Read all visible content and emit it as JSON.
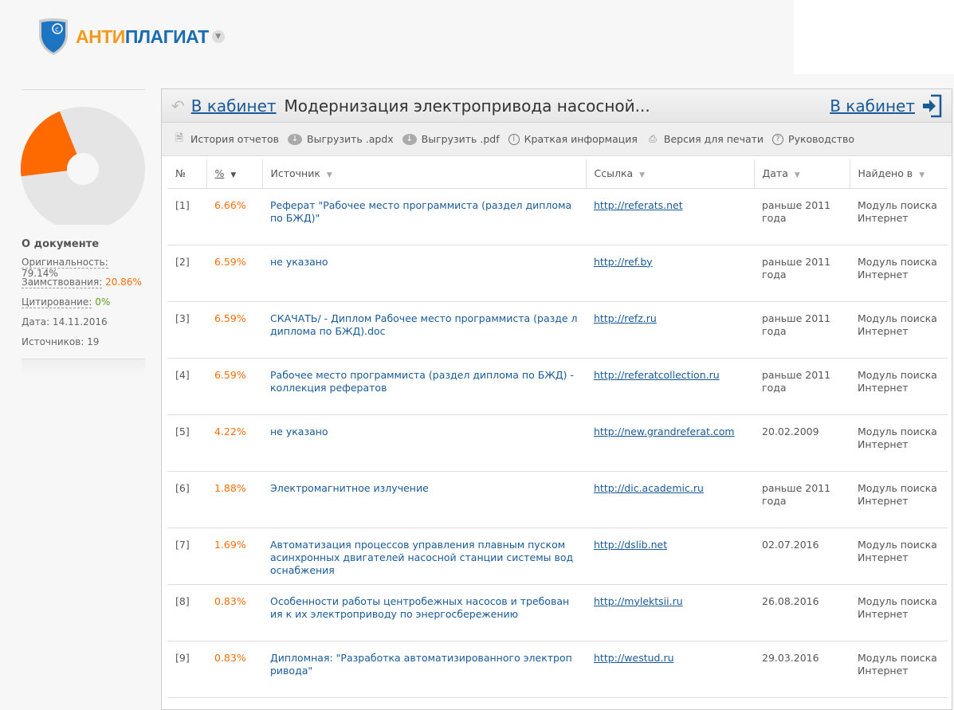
{
  "logo": {
    "part1": "АНТИ",
    "part2": "ПЛАГИАТ"
  },
  "chart_data": {
    "type": "pie",
    "values": [
      79.14,
      20.86
    ],
    "labels": [
      "Оригинальность",
      "Заимствования"
    ],
    "colors": [
      "#e5e5e5",
      "#ff6a00"
    ]
  },
  "sidebar": {
    "title": "О документе",
    "originality_label": "Оригинальность:",
    "originality": "79.14%",
    "borrowing_label": "Заимствования:",
    "borrowing": "20.86%",
    "citation_label": "Цитирование:",
    "citation": "0%",
    "date": "Дата: 14.11.2016",
    "sources": "Источников: 19"
  },
  "header": {
    "back_link": "В кабинет",
    "title": "Модернизация электропривода насосной...",
    "right_link": "В кабинет"
  },
  "toolbar": [
    "История отчетов",
    "Выгрузить .apdx",
    "Выгрузить .pdf",
    "Краткая информация",
    "Версия для печати",
    "Руководство"
  ],
  "table": {
    "columns": [
      "№",
      "%",
      "Источник",
      "Ссылка",
      "Дата",
      "Найдено в"
    ],
    "rows": [
      [
        "[1]",
        "6.66%",
        "Реферат \"Рабочее место программиста (раздел диплома по БЖД)\"",
        "http://referats.net",
        "раньше 2011 года",
        "Модуль поиска Интернет"
      ],
      [
        "[2]",
        "6.59%",
        "не указано",
        "http://ref.by",
        "раньше 2011 года",
        "Модуль поиска Интернет"
      ],
      [
        "[3]",
        "6.59%",
        "СКАЧАТЬ/ - Диплом Рабочее место программиста (разде л диплома по БЖД).doc",
        "http://refz.ru",
        "раньше 2011 года",
        "Модуль поиска Интернет"
      ],
      [
        "[4]",
        "6.59%",
        "Рабочее место программиста (раздел диплома по БЖД) - коллекция рефератов",
        "http://referatcollection.ru",
        "раньше 2011 года",
        "Модуль поиска Интернет"
      ],
      [
        "[5]",
        "4.22%",
        "не указано",
        "http://new.grandreferat.com",
        "20.02.2009",
        "Модуль поиска Интернет"
      ],
      [
        "[6]",
        "1.88%",
        "Электромагнитное излучение",
        "http://dic.academic.ru",
        "раньше 2011 года",
        "Модуль поиска Интернет"
      ],
      [
        "[7]",
        "1.69%",
        "Автоматизация процессов управления плавным пуском асинхронных двигателей насосной станции системы вод оснабжения",
        "http://dslib.net",
        "02.07.2016",
        "Модуль поиска Интернет"
      ],
      [
        "[8]",
        "0.83%",
        "Особенности работы центробежных насосов и требован ия к их электроприводу по энергосбережению",
        "http://mylektsii.ru",
        "26.08.2016",
        "Модуль поиска Интернет"
      ],
      [
        "[9]",
        "0.83%",
        "Дипломная: \"Разработка автоматизированного электроп ривода\"",
        "http://westud.ru",
        "29.03.2016",
        "Модуль поиска Интернет"
      ]
    ]
  }
}
